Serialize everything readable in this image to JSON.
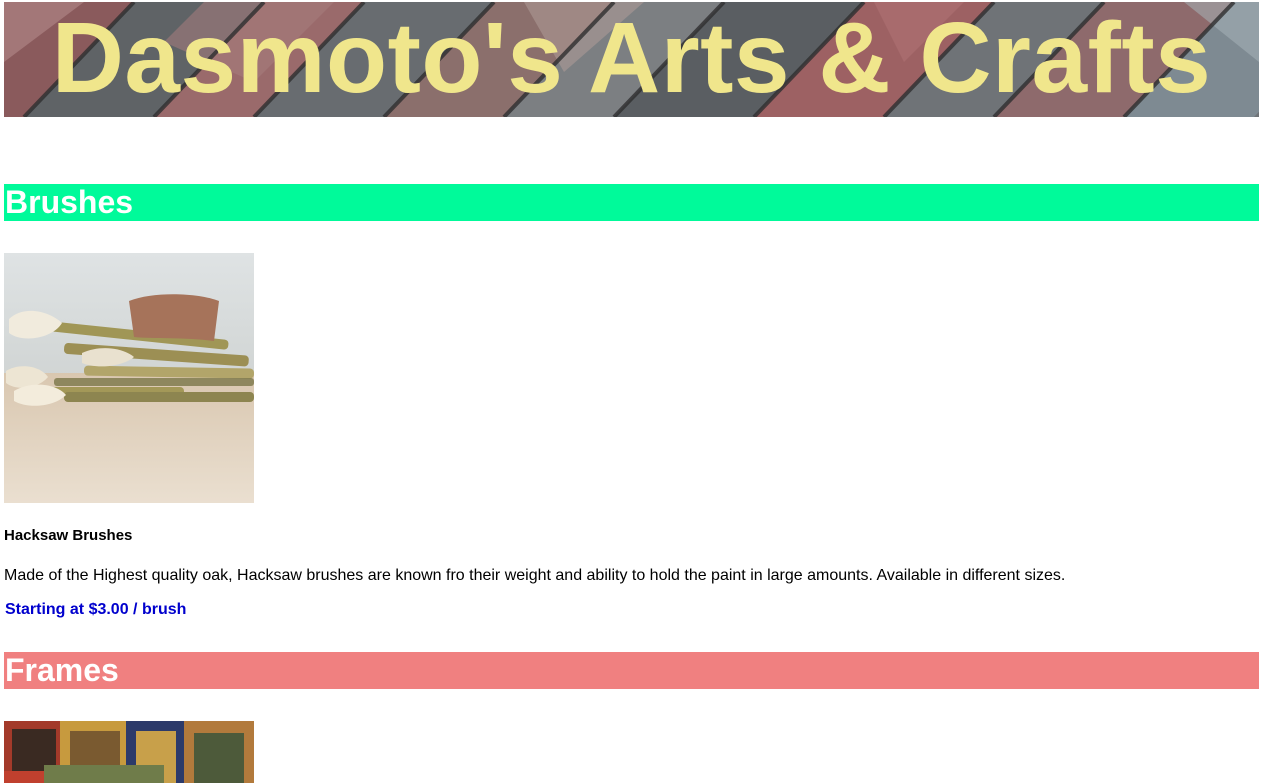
{
  "banner": {
    "title": "Dasmoto's Arts & Crafts",
    "title_color": "#f0e68c",
    "background": "brick-pattern-photo"
  },
  "sections": [
    {
      "heading": "Brushes",
      "heading_bg": "#00fa9a",
      "image": "hacksaw-brushes-photo",
      "product_name": "Hacksaw Brushes",
      "description": "Made of the Highest quality oak, Hacksaw brushes are known fro their weight and ability to hold the paint in large amounts. Available in different sizes.",
      "price": "Starting at $3.00 / brush",
      "price_color": "#0000cd"
    },
    {
      "heading": "Frames",
      "heading_bg": "#f08080",
      "image": "picture-frames-photo"
    }
  ]
}
